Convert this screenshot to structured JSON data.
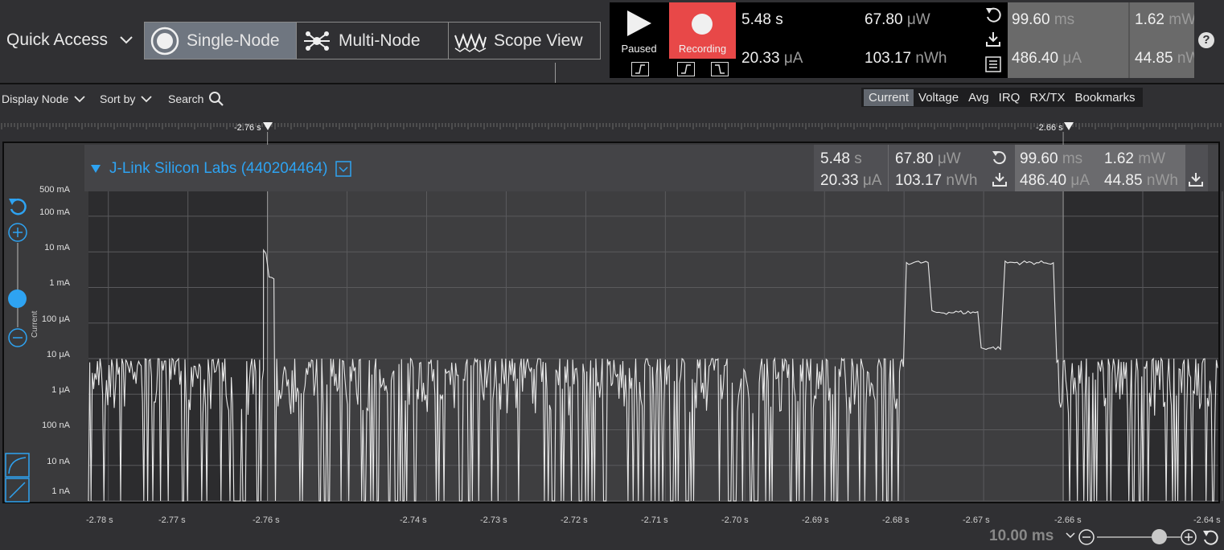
{
  "quick_access": {
    "label": "Quick Access"
  },
  "modes": [
    {
      "label": "Single-Node",
      "active": true
    },
    {
      "label": "Multi-Node",
      "active": false
    },
    {
      "label": "Scope View",
      "active": false
    }
  ],
  "recorder": {
    "paused_label": "Paused",
    "recording_label": "Recording",
    "accent_color": "#e84848"
  },
  "summary": {
    "time": "5.48",
    "time_unit": "s",
    "current": "20.33",
    "current_unit": "μA",
    "power": "67.80",
    "power_unit": "μW",
    "energy": "103.17",
    "energy_unit": "nWh",
    "range_time": "99.60",
    "range_time_unit": "ms",
    "range_current": "486.40",
    "range_current_unit": "μA",
    "range_power": "1.62",
    "range_power_unit": "mW",
    "range_energy": "44.85",
    "range_energy_unit": "nWh"
  },
  "help_label": "?",
  "toolbar": {
    "display_node": "Display Node",
    "sort_by": "Sort by",
    "search": "Search",
    "tabs": [
      {
        "label": "Current",
        "active": true
      },
      {
        "label": "Voltage",
        "active": false
      },
      {
        "label": "Avg",
        "active": false
      },
      {
        "label": "IRQ",
        "active": false
      },
      {
        "label": "RX/TX",
        "active": false
      },
      {
        "label": "Bookmarks",
        "active": false
      }
    ]
  },
  "markers": {
    "left": "-2.76 s",
    "right": "-2.66 s"
  },
  "node": {
    "title": "J-Link Silicon Labs (440204464)",
    "accent_color": "#2ea3f2",
    "time": "5.48",
    "time_unit": "s",
    "current": "20.33",
    "current_unit": "μA",
    "power": "67.80",
    "power_unit": "μW",
    "energy": "103.17",
    "energy_unit": "nWh",
    "range_time": "99.60",
    "range_time_unit": "ms",
    "range_current": "486.40",
    "range_current_unit": "μA",
    "range_power": "1.62",
    "range_power_unit": "mW",
    "range_energy": "44.85",
    "range_energy_unit": "nWh"
  },
  "chart_data": {
    "type": "line",
    "ylabel": "Current",
    "yscale": "log",
    "y_ticks": [
      "500 mA",
      "100 mA",
      "10 mA",
      "1 mA",
      "100 μA",
      "10 μA",
      "1 μA",
      "100 nA",
      "10 nA",
      "1 nA"
    ],
    "x_ticks": [
      "-2.78 s",
      "-2.77 s",
      "-2.76 s",
      "-2.74 s",
      "-2.73 s",
      "-2.72 s",
      "-2.71 s",
      "-2.70 s",
      "-2.69 s",
      "-2.68 s",
      "-2.67 s",
      "-2.66 s",
      "-2.64 s"
    ],
    "xlim": [
      -2.7825,
      -2.6405
    ],
    "ylim_amps": [
      1e-09,
      0.5
    ],
    "grid": true,
    "selection": [
      -2.76,
      -2.66
    ],
    "series": [
      {
        "noise_band_amps": [
          1e-09,
          1e-05
        ],
        "segments": [
          {
            "x": [
              -2.7825,
              -2.7605
            ],
            "level": "noise"
          },
          {
            "x": [
              -2.7605,
              -2.76
            ],
            "amps": 0.01
          },
          {
            "x": [
              -2.7598,
              -2.759
            ],
            "amps": 0.002
          },
          {
            "x": [
              -2.759,
              -2.68
            ],
            "level": "noise"
          },
          {
            "x": [
              -2.6797,
              -2.6768
            ],
            "amps": 0.005
          },
          {
            "x": [
              -2.6765,
              -2.6707
            ],
            "amps": 0.0002
          },
          {
            "x": [
              -2.6703,
              -2.6677
            ],
            "amps": 2e-05
          },
          {
            "x": [
              -2.6673,
              -2.6612
            ],
            "amps": 0.005
          },
          {
            "x": [
              -2.6608,
              -2.6405
            ],
            "level": "noise"
          }
        ]
      }
    ]
  },
  "zoom": {
    "value": "10.00 ms"
  }
}
